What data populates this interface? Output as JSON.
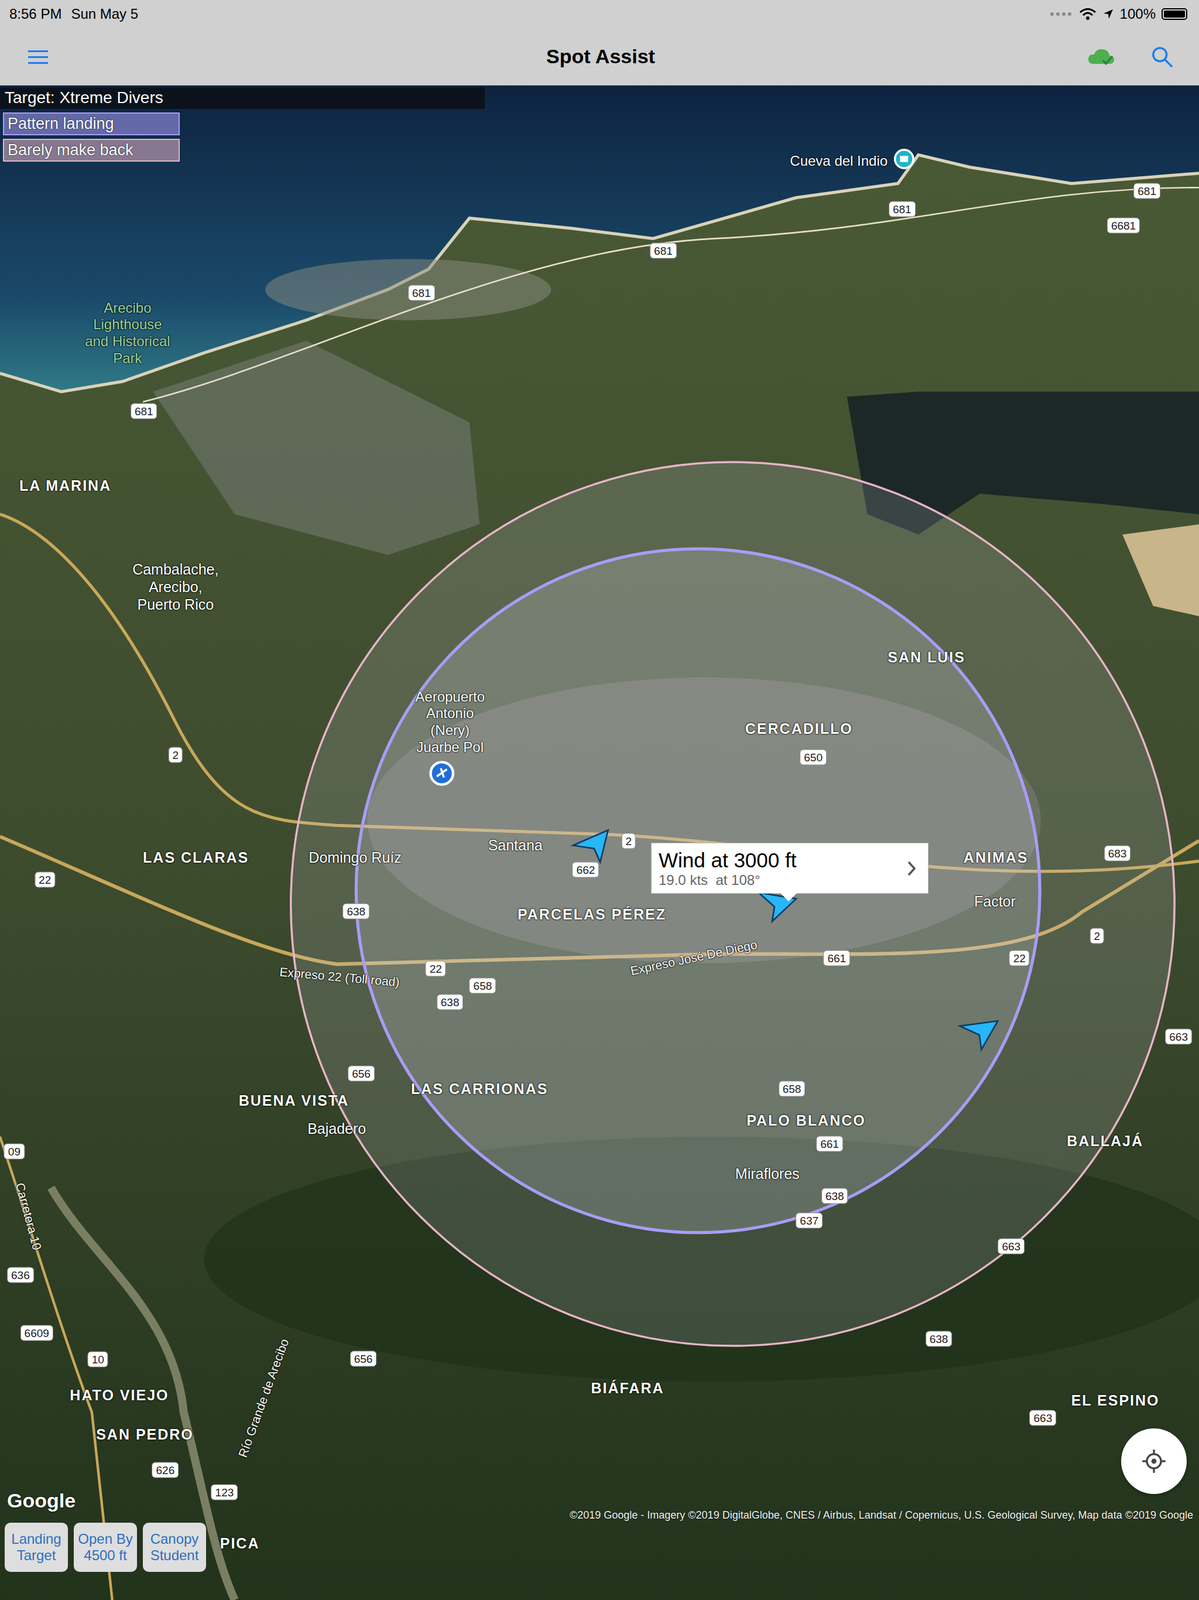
{
  "status_bar": {
    "time": "8:56 PM",
    "date": "Sun May 5",
    "battery": "100%",
    "battery_level": 1.0
  },
  "nav": {
    "title": "Spot Assist"
  },
  "target": {
    "label": "Target: Xtreme Divers"
  },
  "legend": [
    {
      "label": "Pattern landing",
      "color": "#a99cf5"
    },
    {
      "label": "Barely make back",
      "color": "#e8b4c8"
    }
  ],
  "wind_callout": {
    "title": "Wind at 3000 ft",
    "detail": "19.0 kts  at 108°"
  },
  "map": {
    "labels": [
      {
        "text": "Cueva del Indio",
        "kind": "poi"
      },
      {
        "text": "Arecibo\nLighthouse\nand Historical\nPark",
        "kind": "park"
      },
      {
        "text": "LA MARINA",
        "kind": "district"
      },
      {
        "text": "Cambalache,\nArecibo,\nPuerto Rico",
        "kind": "locality"
      },
      {
        "text": "Aeropuerto\nAntonio\n(Nery)\nJuarbe Pol",
        "kind": "poi"
      },
      {
        "text": "SAN LUIS",
        "kind": "district"
      },
      {
        "text": "CERCADILLO",
        "kind": "district"
      },
      {
        "text": "Santana",
        "kind": "locality"
      },
      {
        "text": "Domingo Ruíz",
        "kind": "locality"
      },
      {
        "text": "LAS CLARAS",
        "kind": "district"
      },
      {
        "text": "PARCELAS PÉREZ",
        "kind": "district"
      },
      {
        "text": "ANIMAS",
        "kind": "district"
      },
      {
        "text": "Factor",
        "kind": "locality"
      },
      {
        "text": "Expreso 22 (Toll road)",
        "kind": "road"
      },
      {
        "text": "Expreso José De Diego",
        "kind": "road"
      },
      {
        "text": "LAS CARRIONAS",
        "kind": "district"
      },
      {
        "text": "BUENA VISTA",
        "kind": "district"
      },
      {
        "text": "Bajadero",
        "kind": "locality"
      },
      {
        "text": "PALO BLANCO",
        "kind": "district"
      },
      {
        "text": "BALLAJÁ",
        "kind": "district"
      },
      {
        "text": "Miraflores",
        "kind": "locality"
      },
      {
        "text": "Carretera 10",
        "kind": "road"
      },
      {
        "text": "BIÁFARA",
        "kind": "district"
      },
      {
        "text": "Río Grande de Arecibo",
        "kind": "road"
      },
      {
        "text": "HATO VIEJO",
        "kind": "district"
      },
      {
        "text": "SAN PEDRO",
        "kind": "district"
      },
      {
        "text": "EL ESPINO",
        "kind": "district"
      },
      {
        "text": "PICA",
        "kind": "district"
      }
    ],
    "route_shields": [
      "681",
      "681",
      "681",
      "681",
      "681",
      "6681",
      "2",
      "650",
      "2",
      "662",
      "683",
      "22",
      "638",
      "661",
      "22",
      "2",
      "22",
      "658",
      "638",
      "656",
      "658",
      "661",
      "638",
      "637",
      "663",
      "663",
      "638",
      "656",
      "636",
      "6609",
      "10",
      "626",
      "123",
      "663",
      "09"
    ],
    "attribution_logo": "Google",
    "copyright": "©2019 Google - Imagery ©2019 DigitalGlobe, CNES / Airbus, Landsat / Copernicus, U.S. Geological Survey, Map data ©2019 Google"
  },
  "buttons": [
    {
      "label": "Landing Target"
    },
    {
      "label": "Open By 4500 ft"
    },
    {
      "label": "Canopy Student"
    }
  ]
}
